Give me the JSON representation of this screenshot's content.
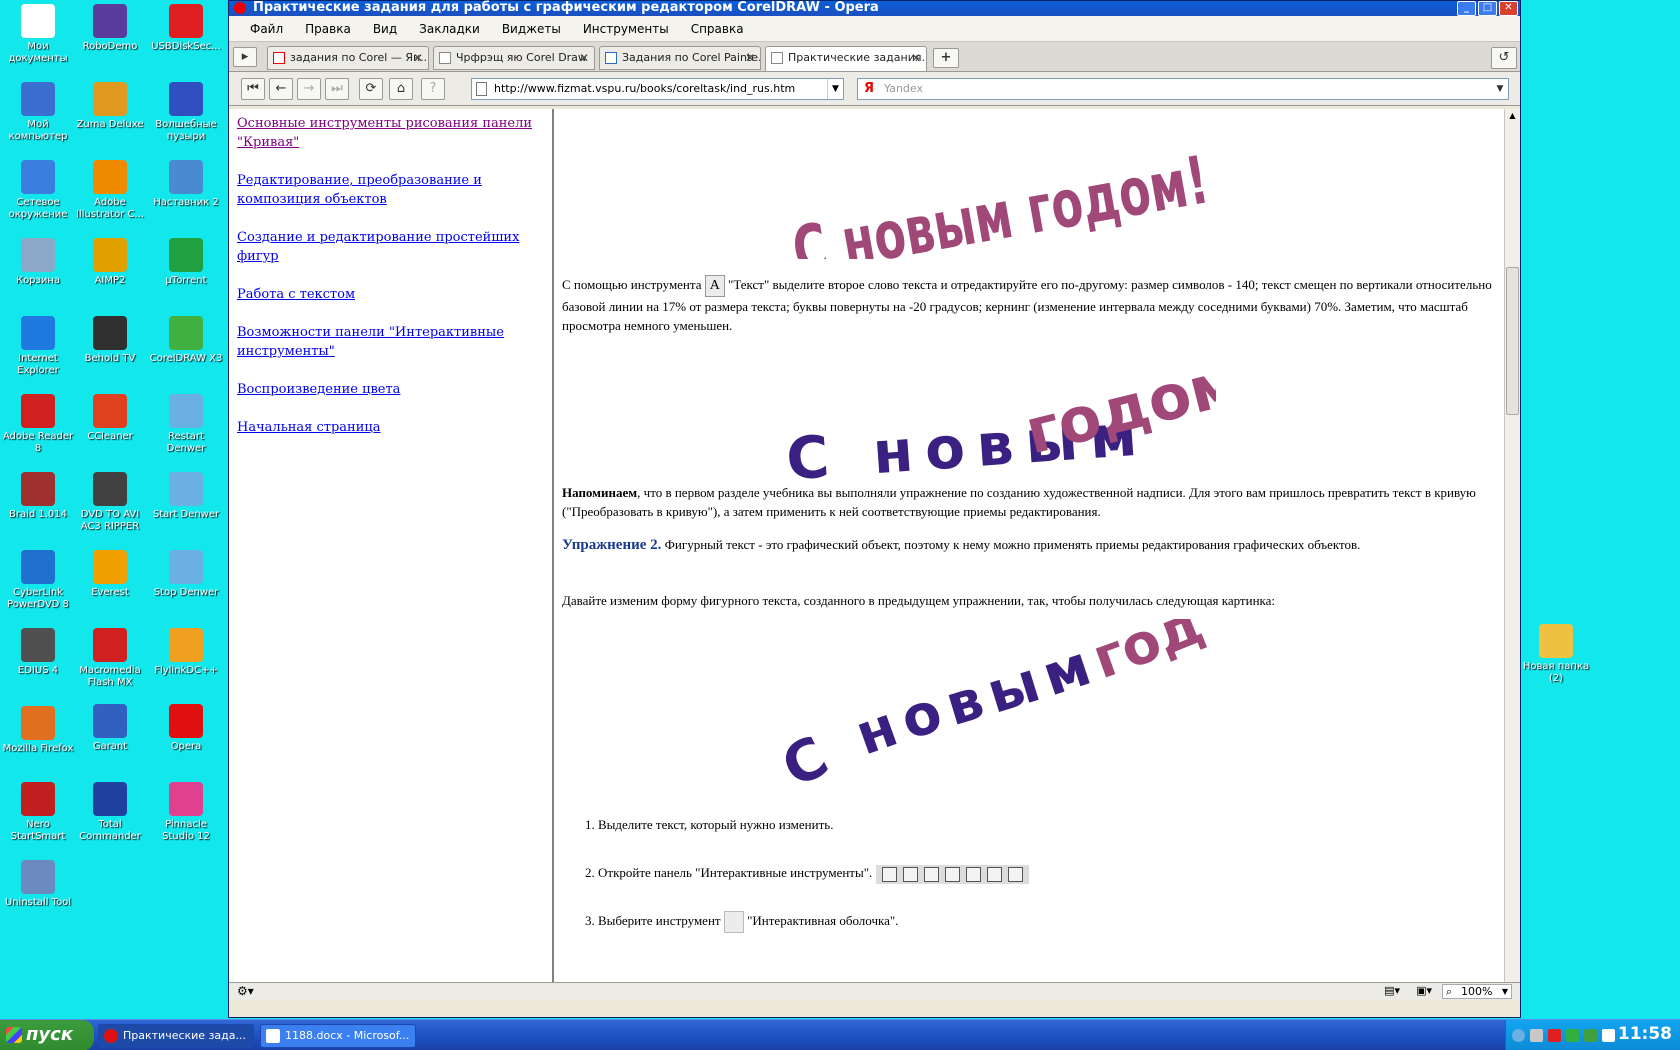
{
  "desktop": {
    "icons": [
      {
        "label": "Мои документы",
        "color": "#ffffff"
      },
      {
        "label": "RoboDemo",
        "color": "#5a3c9c"
      },
      {
        "label": "USBDiskSec...",
        "color": "#e02020"
      },
      {
        "label": "Мой компьютер",
        "color": "#3a6fd0"
      },
      {
        "label": "Zuma Deluxe",
        "color": "#e09a20"
      },
      {
        "label": "Волшебные пузыри",
        "color": "#3050c0"
      },
      {
        "label": "Сетевое окружение",
        "color": "#3a7fe0"
      },
      {
        "label": "Adobe Illustrator C...",
        "color": "#f08a00"
      },
      {
        "label": "Наставник 2",
        "color": "#4a8ad0"
      },
      {
        "label": "Корзина",
        "color": "#8aa8c8"
      },
      {
        "label": "AIMP2",
        "color": "#e0a000"
      },
      {
        "label": "µTorrent",
        "color": "#20a040"
      },
      {
        "label": "Internet Explorer",
        "color": "#1e7ae0"
      },
      {
        "label": "Behold TV",
        "color": "#303030"
      },
      {
        "label": "CorelDRAW X3",
        "color": "#40b040"
      },
      {
        "label": "Adobe Reader 8",
        "color": "#d02020"
      },
      {
        "label": "CCleaner",
        "color": "#e04020"
      },
      {
        "label": "Restart Denwer",
        "color": "#6ab0e0"
      },
      {
        "label": "Braid 1.014",
        "color": "#a03030"
      },
      {
        "label": "DVD TO AVI AC3 RIPPER",
        "color": "#404040"
      },
      {
        "label": "Start Denwer",
        "color": "#6ab0e0"
      },
      {
        "label": "CyberLink PowerDVD 8",
        "color": "#2070d0"
      },
      {
        "label": "Everest",
        "color": "#f0a000"
      },
      {
        "label": "Stop Denwer",
        "color": "#6ab0e0"
      },
      {
        "label": "EDIUS 4",
        "color": "#505050"
      },
      {
        "label": "Macromedia Flash MX",
        "color": "#d02020"
      },
      {
        "label": "FlylinkDC++",
        "color": "#f0a020"
      },
      {
        "label": "Mozilla Firefox",
        "color": "#e07020"
      },
      {
        "label": "Garant",
        "color": "#3060c0"
      },
      {
        "label": "Opera",
        "color": "#e01010"
      },
      {
        "label": "Nero StartSmart",
        "color": "#c02020"
      },
      {
        "label": "Total Commander",
        "color": "#2040a0"
      },
      {
        "label": "Pinnacle Studio 12",
        "color": "#e04090"
      },
      {
        "label": "Uninstall Tool",
        "color": "#6a8ac0"
      },
      {
        "label": "Новая папка (2)",
        "color": "#f0c040"
      }
    ]
  },
  "window": {
    "title": "Практические задания для работы с графическим редактором CorelDRAW - Opera",
    "menu": [
      "Файл",
      "Правка",
      "Вид",
      "Закладки",
      "Виджеты",
      "Инструменты",
      "Справка"
    ],
    "tabs": [
      "задания по Corel — Ян...",
      "Чрфрэщ яю Corel Draw",
      "Задания по Corel Painte...",
      "Практические задания..."
    ],
    "url": "http://www.fizmat.vspu.ru/books/coreltask/ind_rus.htm",
    "search_placeholder": "Yandex",
    "search_logo": "Я",
    "zoom": "100%"
  },
  "sidebar": {
    "links": [
      "Основные инструменты рисования панели \"Кривая\"",
      "Редактирование, преобразование и композиция объектов",
      "Создание и редактирование простейших фигур",
      "Работа с текстом",
      "Возможности панели \"Интерактивные инструменты\"",
      "Воспроизведение цвета",
      "Начальная страница"
    ]
  },
  "article": {
    "art_text_1": "С новым годом!",
    "art_text_2a": "С новым",
    "art_text_2b": "годом!",
    "p1_before": "С помощью инструмента",
    "p1_after": "\"Текст\" выделите второе слово текста и отредактируйте его по-другому: размер символов - 140; текст смещен по вертикали относительно базовой линии на 17% от размера текста; буквы повернуты на -20 градусов; кернинг (изменение интервала между соседними буквами) 70%. Заметим, что масштаб просмотра немного уменьшен.",
    "p2_bold": "Напоминаем",
    "p2_rest": ", что в первом разделе учебника вы выполняли упражнение по созданию художественной надписи. Для этого вам пришлось превратить текст в кривую (\"Преобразовать в кривую\"), а затем применить к ней соответствующие приемы редактирования.",
    "ex_title": "Упражнение 2.",
    "ex_rest": " Фигурный текст - это графический объект, поэтому к нему можно применять приемы редактирования графических объектов.",
    "p3": "Давайте изменим форму фигурного текста, созданного в предыдущем упражнении, так, чтобы получилась следующая картинка:",
    "steps": [
      "Выделите текст, который нужно изменить.",
      "Откройте панель \"Интерактивные инструменты\".",
      "Выберите инструмент"
    ],
    "step3_after": "\"Интерактивная оболочка\".",
    "art_colors": {
      "magenta": "#a04878",
      "purple": "#3a2080"
    }
  },
  "taskbar": {
    "start": "пуск",
    "tasks": [
      "Практические зада...",
      "1188.docx - Microsof..."
    ],
    "clock": "11:58"
  }
}
